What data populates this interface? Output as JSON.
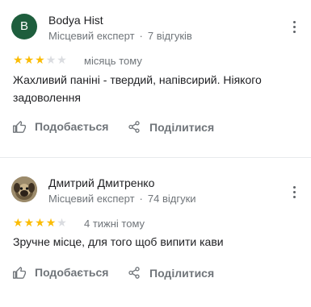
{
  "reviews": [
    {
      "avatar_letter": "B",
      "author": "Bodya Hist",
      "badge": "Місцевий експерт",
      "separator": "·",
      "count": "7 відгуків",
      "rating": 3,
      "max_rating": 5,
      "time": "місяць тому",
      "text": "Жахливий паніні - твердий, напівсирий. Ніякого задоволення",
      "like_label": "Подобається",
      "share_label": "Поділитися"
    },
    {
      "author": "Дмитрий Дмитренко",
      "badge": "Місцевий експерт",
      "separator": "·",
      "count": "74 відгуки",
      "rating": 4,
      "max_rating": 5,
      "time": "4 тижні тому",
      "text": "Зручне місце, для того щоб випити кави",
      "like_label": "Подобається",
      "share_label": "Поділитися"
    }
  ],
  "colors": {
    "avatar_bg": "#1e5e3d",
    "star_on": "#fbbc04",
    "star_off": "#dadce0",
    "secondary_text": "#70757a"
  },
  "icons": {
    "more": "more-vert-icon",
    "like": "thumb-up-icon",
    "share": "share-icon",
    "star": "star-icon"
  }
}
